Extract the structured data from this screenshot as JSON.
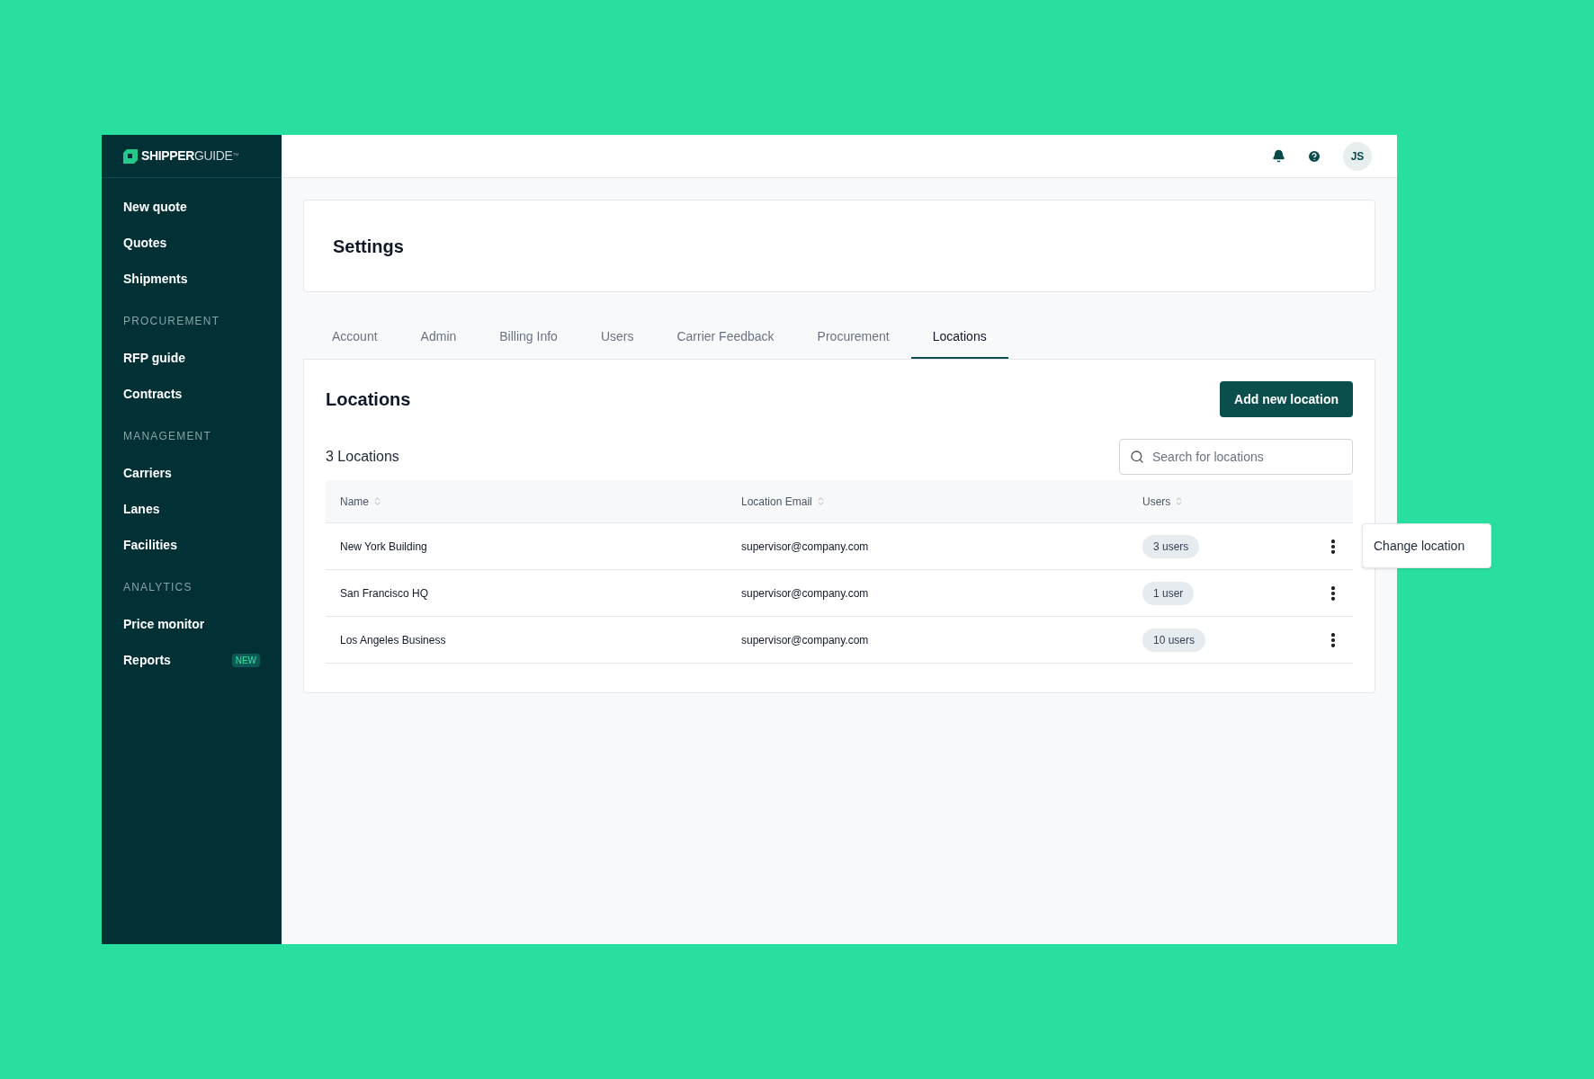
{
  "sidebar": {
    "logo": {
      "bold": "SHIPPER",
      "light": "GUIDE",
      "mark": "™"
    },
    "items": [
      {
        "kind": "link",
        "label": "New quote"
      },
      {
        "kind": "link",
        "label": "Quotes"
      },
      {
        "kind": "link",
        "label": "Shipments"
      },
      {
        "kind": "heading",
        "label": "PROCUREMENT"
      },
      {
        "kind": "link",
        "label": "RFP guide"
      },
      {
        "kind": "link",
        "label": "Contracts"
      },
      {
        "kind": "heading",
        "label": "MANAGEMENT"
      },
      {
        "kind": "link",
        "label": "Carriers"
      },
      {
        "kind": "link",
        "label": "Lanes"
      },
      {
        "kind": "link",
        "label": "Facilities"
      },
      {
        "kind": "heading",
        "label": "ANALYTICS"
      },
      {
        "kind": "link",
        "label": "Price monitor"
      },
      {
        "kind": "link",
        "label": "Reports",
        "badge": "NEW"
      }
    ]
  },
  "header": {
    "avatar": "JS"
  },
  "page": {
    "title": "Settings"
  },
  "tabs": [
    {
      "label": "Account",
      "selected": false
    },
    {
      "label": "Admin",
      "selected": false
    },
    {
      "label": "Billing Info",
      "selected": false
    },
    {
      "label": "Users",
      "selected": false
    },
    {
      "label": "Carrier Feedback",
      "selected": false
    },
    {
      "label": "Procurement",
      "selected": false
    },
    {
      "label": "Locations",
      "selected": true
    }
  ],
  "panel": {
    "title": "Locations",
    "button": "Add new location",
    "count": "3 Locations",
    "search": {
      "placeholder": "Search for locations"
    }
  },
  "table": {
    "columns": [
      "Name",
      "Location Email",
      "Users"
    ],
    "rows": [
      {
        "name": "New York Building",
        "email": "supervisor@company.com",
        "users": "3 users"
      },
      {
        "name": "San Francisco HQ",
        "email": "supervisor@company.com",
        "users": "1 user"
      },
      {
        "name": "Los Angeles Business",
        "email": "supervisor@company.com",
        "users": "10 users"
      }
    ],
    "menu": [
      "Change location"
    ]
  }
}
